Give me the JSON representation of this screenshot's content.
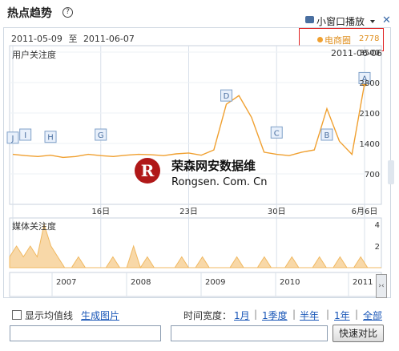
{
  "header": {
    "title": "热点趋势",
    "help_icon": "help-circle-icon",
    "mini_window_label": "小窗口播放",
    "tv_icon": "tv-icon",
    "dropdown_icon": "caret-down-icon",
    "close_icon": "close-icon"
  },
  "chart_header": {
    "start_date": "2011-05-09",
    "range_sep": "至",
    "end_date": "2011-06-07",
    "legend_name": "电商圈",
    "legend_value": "2778",
    "legend_color": "#f0a030"
  },
  "chart_data": [
    {
      "type": "line",
      "title": "用户关注度",
      "corner_date": "2011-06-06",
      "ylim": [
        0,
        3500
      ],
      "y_ticks": [
        "3500",
        "2800",
        "2100",
        "1400",
        "700"
      ],
      "x_tick_labels": [
        "16日",
        "23日",
        "30日",
        "6月6日"
      ],
      "series": [
        {
          "name": "电商圈",
          "color": "#f0a030",
          "x": [
            "2011-05-09",
            "2011-05-10",
            "2011-05-11",
            "2011-05-12",
            "2011-05-13",
            "2011-05-14",
            "2011-05-15",
            "2011-05-16",
            "2011-05-17",
            "2011-05-18",
            "2011-05-19",
            "2011-05-20",
            "2011-05-21",
            "2011-05-22",
            "2011-05-23",
            "2011-05-24",
            "2011-05-25",
            "2011-05-26",
            "2011-05-27",
            "2011-05-28",
            "2011-05-29",
            "2011-05-30",
            "2011-05-31",
            "2011-06-01",
            "2011-06-02",
            "2011-06-03",
            "2011-06-04",
            "2011-06-05",
            "2011-06-06"
          ],
          "values": [
            1150,
            1120,
            1100,
            1130,
            1080,
            1100,
            1150,
            1120,
            1100,
            1130,
            1150,
            1140,
            1120,
            1160,
            1180,
            1130,
            1250,
            2300,
            2500,
            2000,
            1200,
            1150,
            1120,
            1200,
            1250,
            2200,
            1450,
            1150,
            2778
          ]
        }
      ],
      "event_markers": [
        "A",
        "B",
        "C",
        "D",
        "G",
        "H",
        "I",
        "J"
      ]
    },
    {
      "type": "area",
      "title": "媒体关注度",
      "ylim": [
        0,
        4
      ],
      "y_ticks": [
        "4",
        "2"
      ],
      "series": [
        {
          "name": "媒体关注度",
          "color": "#f0b860",
          "values": [
            1,
            2,
            1,
            2,
            1,
            4,
            2,
            1,
            0,
            0,
            1,
            0,
            0,
            0,
            0,
            1,
            0,
            0,
            2,
            0,
            1,
            0,
            0,
            0,
            0,
            1,
            0,
            0,
            1,
            0,
            0,
            0,
            0,
            1,
            0,
            0,
            0,
            1,
            0,
            0,
            0,
            1,
            0,
            0,
            0,
            1,
            0,
            0,
            1,
            0,
            0,
            1,
            0,
            0,
            0
          ]
        }
      ]
    },
    {
      "type": "area",
      "title": "",
      "x_tick_labels": [
        "2007",
        "2008",
        "2009",
        "2010",
        "2011"
      ]
    }
  ],
  "watermark": {
    "brand": "荣森网安数据维",
    "url": "Rongsen. Com. Cn",
    "logo_letter": "R"
  },
  "footer": {
    "show_avg_label": "显示均值线",
    "gen_image_label": "生成图片",
    "time_width_label": "时间宽度：",
    "ranges": [
      "1月",
      "1季度",
      "半年",
      "1年",
      "全部"
    ],
    "separator": "|",
    "compare_button": "快速对比",
    "input1_value": "",
    "input2_value": ""
  }
}
